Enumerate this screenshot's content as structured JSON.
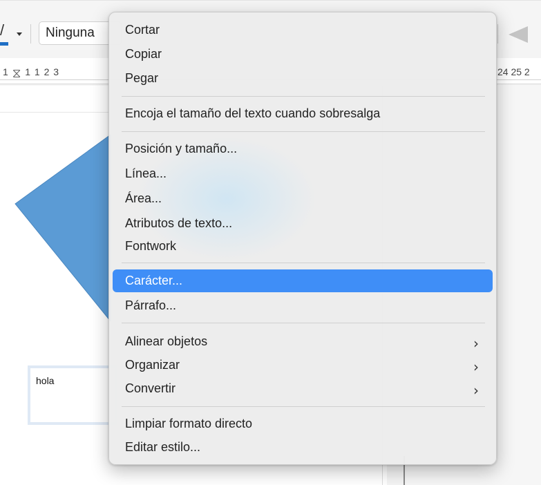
{
  "toolbar": {
    "paragraph_style_value": "Ninguna",
    "font_color_icon": "font-color-icon",
    "font_color_accent": "#1f6fc5",
    "arrow_style_icon": "line-arrow-icon"
  },
  "ruler": {
    "left_ticks": [
      "1",
      "1",
      "1",
      "2",
      "3"
    ],
    "right_ticks": "24 25 2"
  },
  "document": {
    "shape_color": "#5b9bd5",
    "textbox_text": "hola"
  },
  "context_menu": {
    "highlight_color": "#3f8ef7",
    "items": [
      {
        "label": "Cortar"
      },
      {
        "label": "Copiar"
      },
      {
        "label": "Pegar"
      },
      {
        "label": "Encoja el tamaño del texto cuando sobresalga"
      },
      {
        "label": "Posición y tamaño..."
      },
      {
        "label": "Línea..."
      },
      {
        "label": "Área..."
      },
      {
        "label": "Atributos de texto..."
      },
      {
        "label": "Fontwork"
      },
      {
        "label": "Carácter...",
        "highlighted": true
      },
      {
        "label": "Párrafo..."
      },
      {
        "label": "Alinear objetos",
        "submenu": true
      },
      {
        "label": "Organizar",
        "submenu": true
      },
      {
        "label": "Convertir",
        "submenu": true
      },
      {
        "label": "Limpiar formato directo"
      },
      {
        "label": "Editar estilo..."
      }
    ],
    "submenu_glyph": "›"
  }
}
